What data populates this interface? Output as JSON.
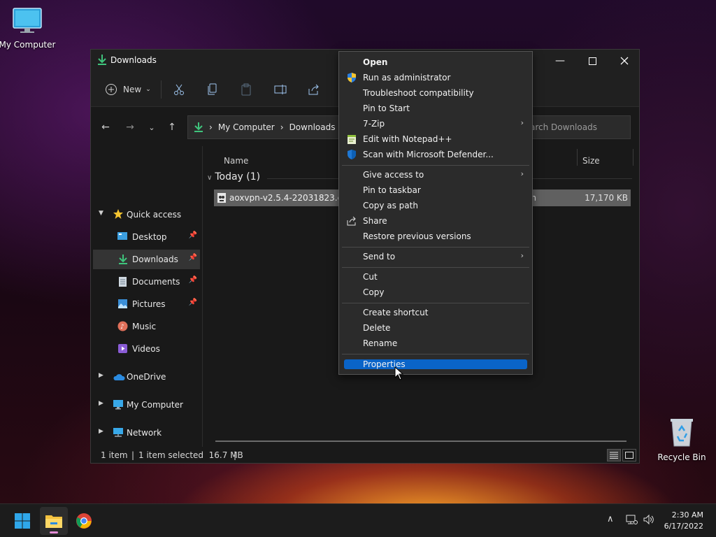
{
  "desktop": {
    "my_computer_label": "My Computer",
    "recycle_bin_label": "Recycle Bin"
  },
  "window": {
    "title": "Downloads",
    "toolbar": {
      "new_label": "New"
    },
    "address": {
      "crumbs": [
        "My Computer",
        "Downloads"
      ],
      "search_placeholder": "Search Downloads"
    },
    "nav": {
      "quick_access": "Quick access",
      "items": [
        {
          "label": "Desktop"
        },
        {
          "label": "Downloads"
        },
        {
          "label": "Documents"
        },
        {
          "label": "Pictures"
        },
        {
          "label": "Music"
        },
        {
          "label": "Videos"
        }
      ],
      "onedrive": "OneDrive",
      "my_computer": "My Computer",
      "network": "Network"
    },
    "columns": {
      "name": "Name",
      "size": "Size"
    },
    "group": "Today (1)",
    "file": {
      "name": "aoxvpn-v2.5.4-22031823.exe",
      "type_partial": "on",
      "size": "17,170 KB"
    },
    "status": {
      "count": "1 item",
      "selected": "1 item selected  16.7 MB"
    }
  },
  "context_menu": {
    "items": [
      {
        "label": "Open"
      },
      {
        "label": "Run as administrator"
      },
      {
        "label": "Troubleshoot compatibility"
      },
      {
        "label": "Pin to Start"
      },
      {
        "label": "7-Zip"
      },
      {
        "label": "Edit with Notepad++"
      },
      {
        "label": "Scan with Microsoft Defender..."
      },
      {
        "label": "Give access to"
      },
      {
        "label": "Pin to taskbar"
      },
      {
        "label": "Copy as path"
      },
      {
        "label": "Share"
      },
      {
        "label": "Restore previous versions"
      },
      {
        "label": "Send to"
      },
      {
        "label": "Cut"
      },
      {
        "label": "Copy"
      },
      {
        "label": "Create shortcut"
      },
      {
        "label": "Delete"
      },
      {
        "label": "Rename"
      },
      {
        "label": "Properties"
      }
    ]
  },
  "taskbar": {
    "time": "2:30 AM",
    "date": "6/17/2022"
  },
  "colors": {
    "accent": "#0a64c8",
    "selection": "#606060"
  }
}
